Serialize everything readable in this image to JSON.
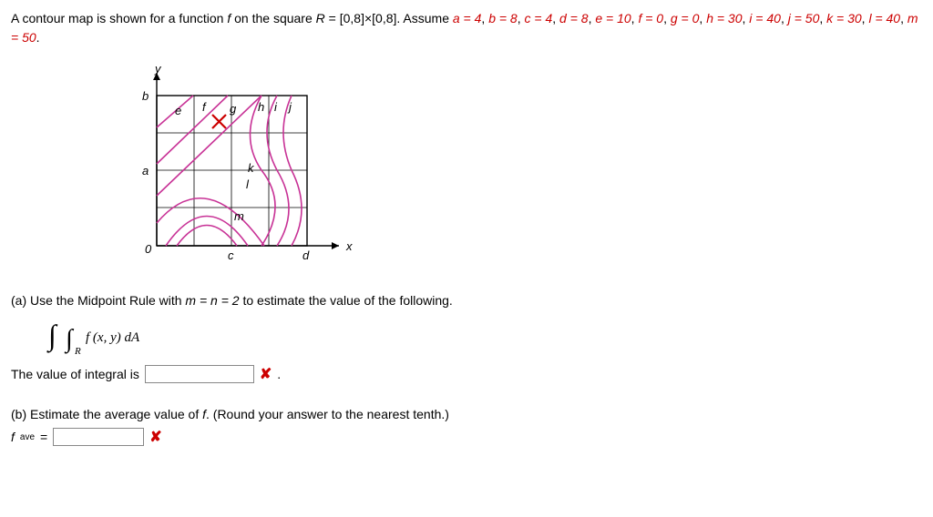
{
  "intro": {
    "pre1": "A contour map is shown for a function ",
    "fvar": "f",
    "pre2": " on the square ",
    "Rvar": "R",
    "pre3": " = [0,8]×[0,8]. Assume ",
    "a": "a = 4",
    "b": "b = 8",
    "c": "c = 4",
    "d": "d = 8",
    "e": "e = 10",
    "f": "f = 0",
    "g": "g = 0",
    "h": "h = 30",
    "i": "i = 40",
    "j": "j = 50",
    "k": "k = 30",
    "l": "l = 40",
    "m": "m = 50",
    "sep": ", ",
    "end": "."
  },
  "fig": {
    "y": "y",
    "x": "x",
    "b": "b",
    "a": "a",
    "c": "c",
    "d": "d",
    "origin": "0",
    "lab_e": "e",
    "lab_f": "f",
    "lab_g": "g",
    "lab_h": "h",
    "lab_i": "i",
    "lab_j": "j",
    "lab_k": "k",
    "lab_l": "l",
    "lab_m": "m"
  },
  "partA": {
    "prompt": "(a) Use the Midpoint Rule with ",
    "mn": "m = n = 2",
    "prompt2": " to estimate the value of the following.",
    "integral_fxy": "f (x, y) dA",
    "integral_R": "R",
    "answer_pre": "The value of integral is",
    "answer_post": "."
  },
  "partB": {
    "prompt": "(b) Estimate the average value of ",
    "fvar": "f",
    "prompt2": ". (Round your answer to the nearest tenth.)",
    "fave": "f",
    "fave_sub": "ave",
    "eq": " = "
  },
  "chart_data": {
    "type": "contour",
    "domain": {
      "x": [
        0,
        8
      ],
      "y": [
        0,
        8
      ]
    },
    "axis_ticks": {
      "x_labels": [
        "c",
        "d"
      ],
      "x_values": [
        4,
        8
      ],
      "y_labels": [
        "a",
        "b"
      ],
      "y_values": [
        4,
        8
      ]
    },
    "contour_parameters": {
      "a": 4,
      "b": 8,
      "c": 4,
      "d": 8,
      "e": 10,
      "f": 0,
      "g": 0,
      "h": 30,
      "i": 40,
      "j": 50,
      "k": 30,
      "l": 40,
      "m": 50
    },
    "contour_label_positions_note": "letters e–m label contour curves inside the 8×8 square; see parameter values above"
  }
}
